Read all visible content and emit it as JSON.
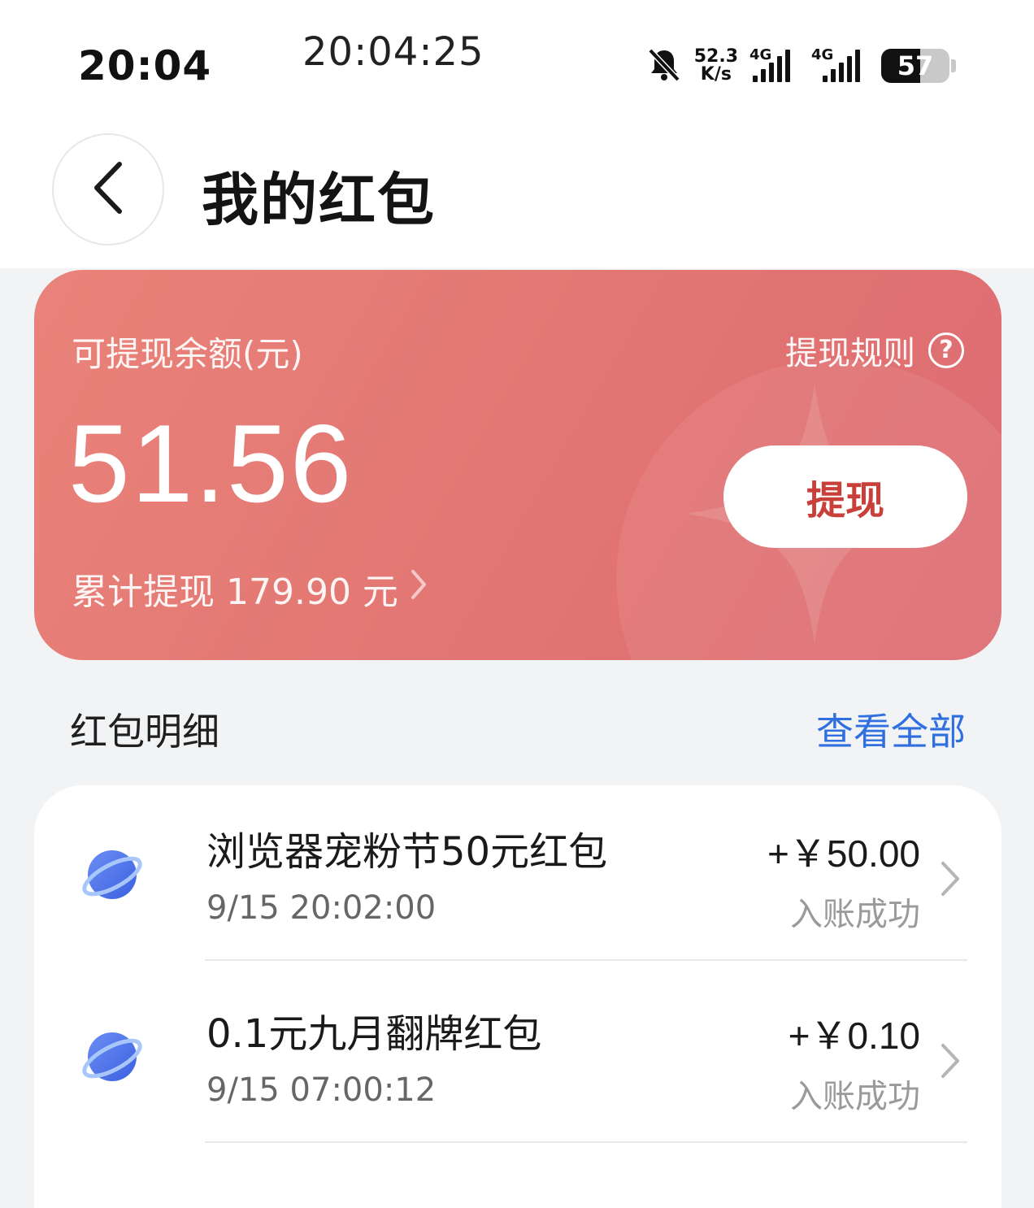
{
  "status_bar": {
    "time": "20:04",
    "clock": "20:04:25",
    "net_speed_value": "52.3",
    "net_speed_unit": "K/s",
    "sim1_type": "4G",
    "sim2_type": "4G",
    "battery_level": "57",
    "battery_fraction": 0.57
  },
  "header": {
    "title": "我的红包"
  },
  "balance_card": {
    "label": "可提现余额(元)",
    "rules_label": "提现规则",
    "amount": "51.56",
    "withdraw_button": "提现",
    "total_withdrawn": "累计提现 179.90 元"
  },
  "details": {
    "title": "红包明细",
    "view_all": "查看全部",
    "items": [
      {
        "title": "浏览器宠粉节50元红包",
        "time": "9/15 20:02:00",
        "amount": "+￥50.00",
        "status": "入账成功"
      },
      {
        "title": "0.1元九月翻牌红包",
        "time": "9/15 07:00:12",
        "amount": "+￥0.10",
        "status": "入账成功"
      }
    ]
  }
}
